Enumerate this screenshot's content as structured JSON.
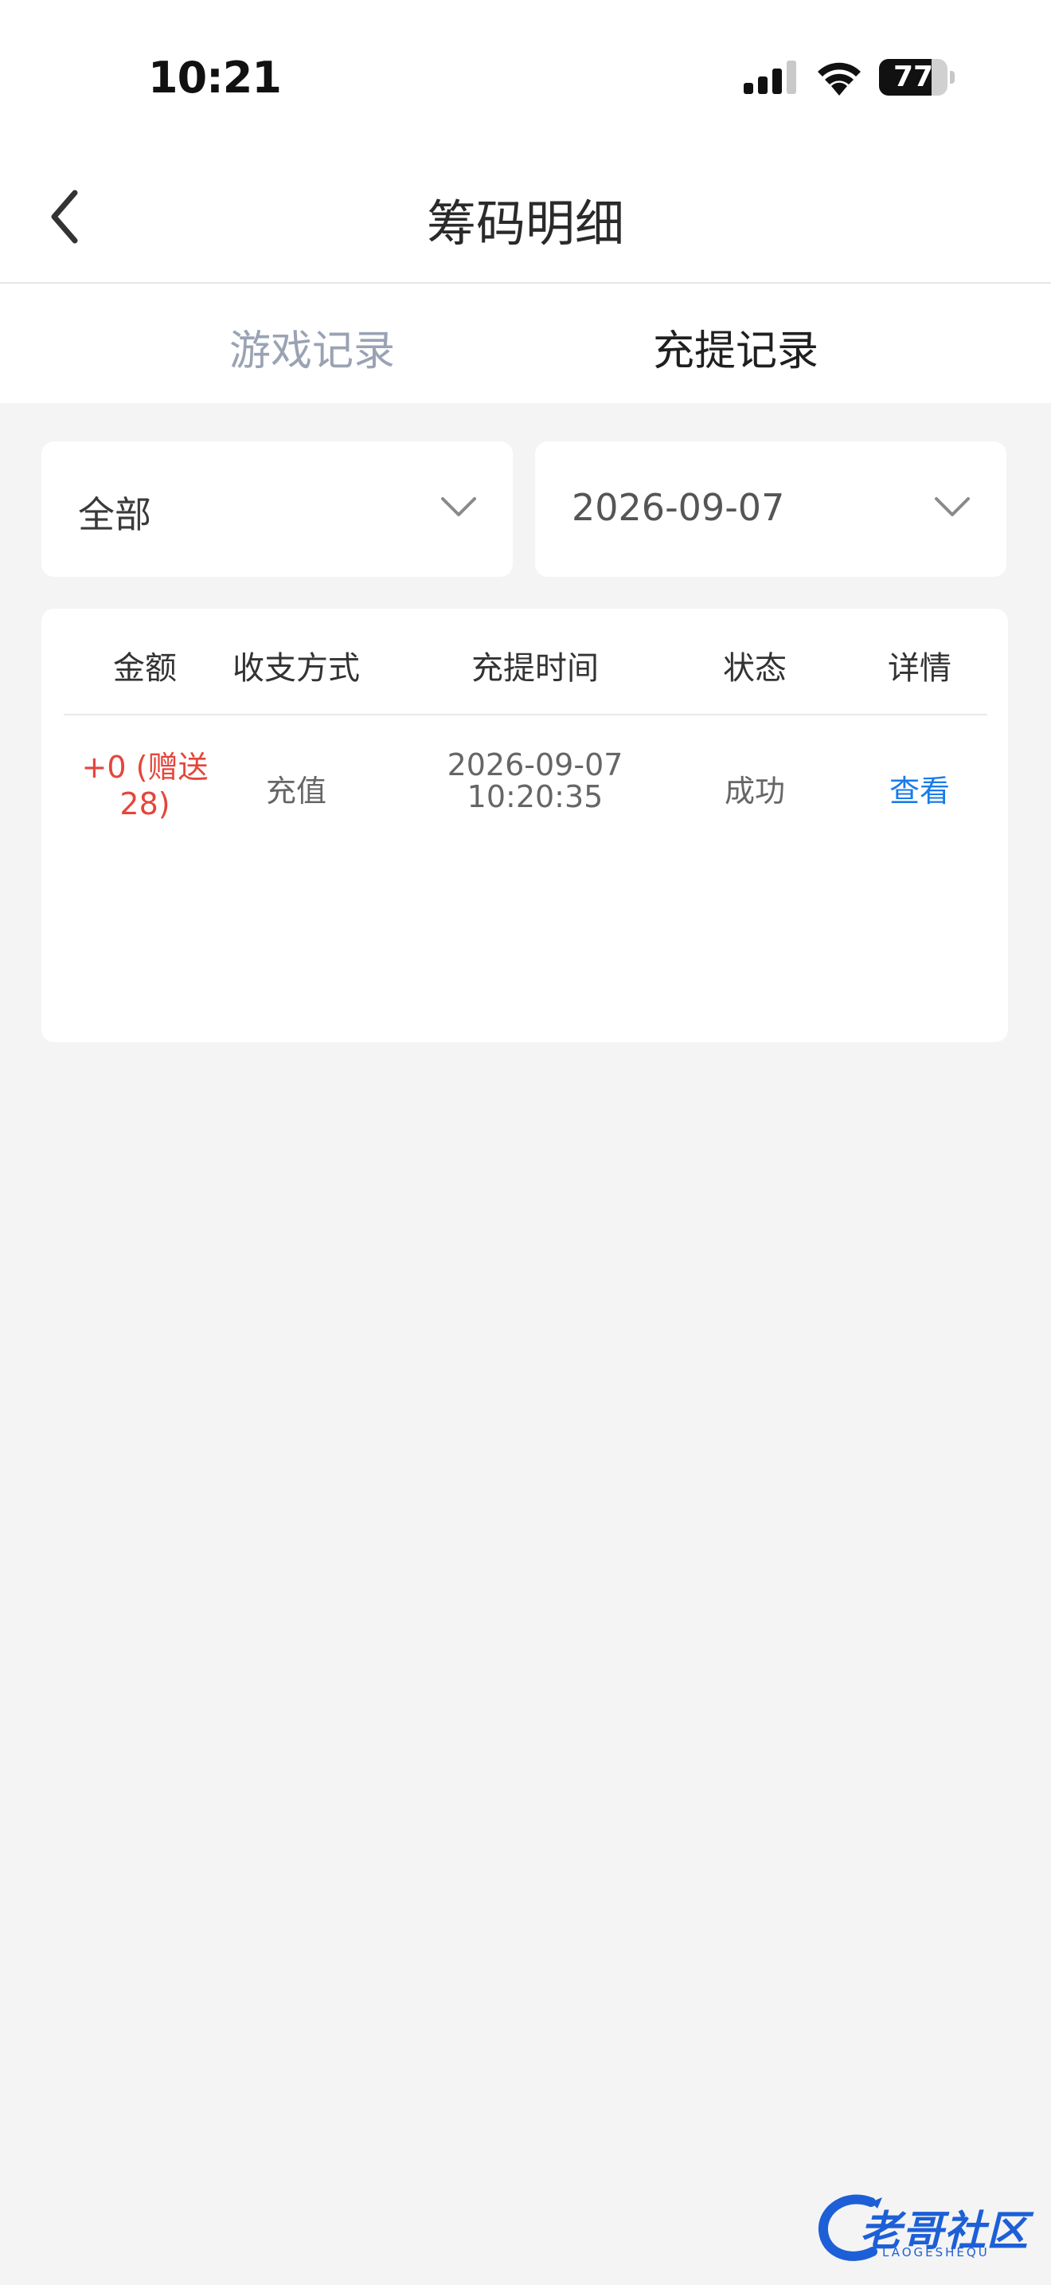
{
  "status_bar": {
    "time": "10:21",
    "battery": "77",
    "battery_level": 0.77
  },
  "header": {
    "title": "筹码明细"
  },
  "tabs": [
    {
      "label": "游戏记录",
      "active": false
    },
    {
      "label": "充提记录",
      "active": true
    }
  ],
  "filters": {
    "type_value": "全部",
    "date_value": "2026-09-07"
  },
  "table": {
    "headers": [
      "金额",
      "收支方式",
      "充提时间",
      "状态",
      "详情"
    ],
    "rows": [
      {
        "amount_line1": "+0 (赠送",
        "amount_line2": "28)",
        "method": "充值",
        "time_date": "2026-09-07",
        "time_clock": "10:20:35",
        "status": "成功",
        "detail": "查看"
      }
    ]
  },
  "watermark": {
    "text": "老哥社区",
    "subtext": "LAOGESHEQU"
  },
  "colors": {
    "background": "#f4f4f4",
    "amount": "#e5453a",
    "link": "#1a7bea",
    "inactive_tab": "#9aa3b4"
  }
}
